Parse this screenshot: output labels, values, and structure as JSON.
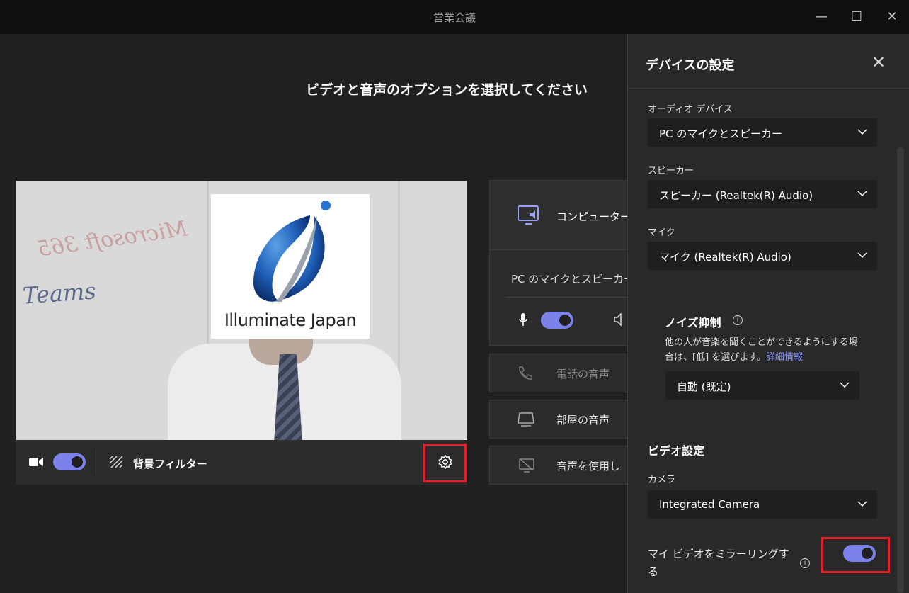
{
  "window": {
    "title": "営業会議",
    "minimize_icon": "minimize-icon",
    "maximize_icon": "maximize-icon",
    "close_icon": "close-icon"
  },
  "main": {
    "heading": "ビデオと音声のオプションを選択してください",
    "preview": {
      "whiteboard_line1": "Microsoft 365",
      "whiteboard_line2": "Teams",
      "logo_text": "Illuminate Japan"
    },
    "controls": {
      "camera_toggle": true,
      "background_filter_label": "背景フィルター",
      "settings_icon": "gear-icon"
    },
    "audio_options": {
      "computer_audio_label": "コンピューターの",
      "device_name": "PC のマイクとスピーカー",
      "mic_toggle": true,
      "phone_audio_label": "電話の音声",
      "room_audio_label": "部屋の音声",
      "no_audio_label": "音声を使用し"
    }
  },
  "settings_panel": {
    "title": "デバイスの設定",
    "audio_device_label": "オーディオ デバイス",
    "audio_device_value": "PC のマイクとスピーカー",
    "speaker_label": "スピーカー",
    "speaker_value": "スピーカー (Realtek(R) Audio)",
    "mic_label": "マイク",
    "mic_value": "マイク (Realtek(R) Audio)",
    "noise": {
      "title": "ノイズ抑制",
      "desc_line1": "他の人が音楽を聞くことができるようにする場",
      "desc_line2": "合は、[低] を選びます。",
      "link": "詳細情報",
      "value": "自動 (既定)"
    },
    "video_section_title": "ビデオ設定",
    "camera_label": "カメラ",
    "camera_value": "Integrated Camera",
    "mirror_label_line1": "マイ ビデオをミラーリングす",
    "mirror_label_line2": "る",
    "mirror_toggle": true
  },
  "colors": {
    "accent": "#7b83eb",
    "highlight": "#e0212b",
    "link": "#8e9bff"
  }
}
